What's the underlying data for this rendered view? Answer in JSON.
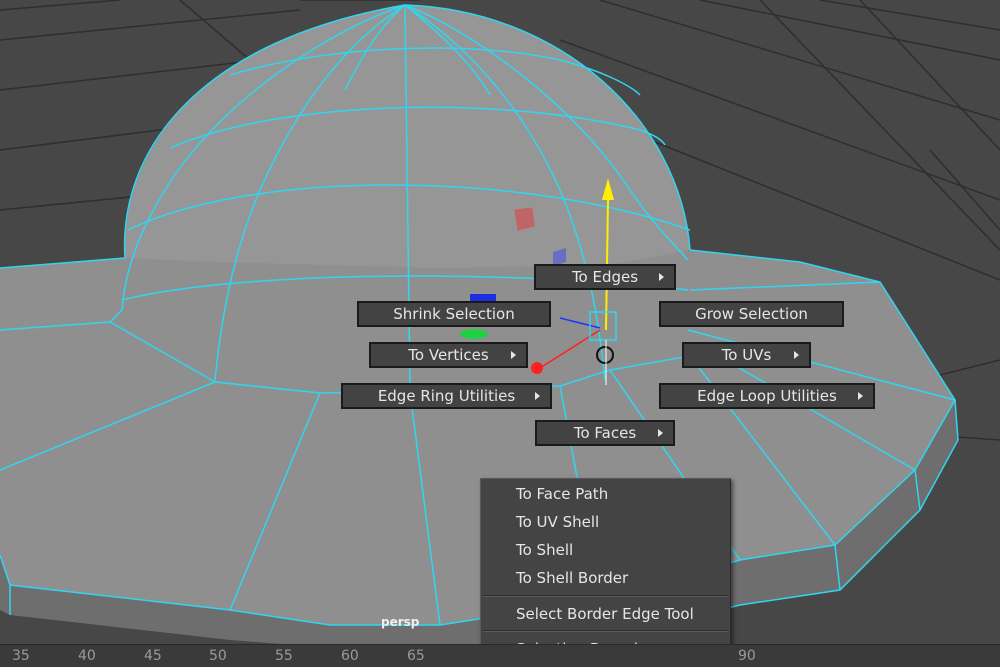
{
  "viewport": {
    "camera_label": "persp",
    "wireframe_color": "#2fd6f2",
    "background_color": "#474747",
    "mesh_color": "#8e8e8e"
  },
  "marking_menu": {
    "north": {
      "label": "To Edges",
      "has_submenu": true
    },
    "west": {
      "label": "Shrink Selection",
      "has_submenu": false
    },
    "east": {
      "label": "Grow Selection",
      "has_submenu": false
    },
    "west_lower": {
      "label": "To Vertices",
      "has_submenu": true
    },
    "east_lower": {
      "label": "To UVs",
      "has_submenu": true
    },
    "southwest": {
      "label": "Edge Ring Utilities",
      "has_submenu": true
    },
    "southeast": {
      "label": "Edge Loop Utilities",
      "has_submenu": true
    },
    "south": {
      "label": "To Faces",
      "has_submenu": true
    }
  },
  "submenu": {
    "items": [
      "To Face Path",
      "To UV Shell",
      "To Shell",
      "To Shell Border",
      "Select Border Edge Tool",
      "Selection Boundary"
    ]
  },
  "timeline": {
    "ticks": [
      "35",
      "40",
      "45",
      "50",
      "55",
      "60",
      "65",
      "90"
    ]
  },
  "manipulator": {
    "y_color": "#ffee00",
    "x_color": "#ff2020",
    "z_color": "#2233ff",
    "plane_color": "#20d040"
  }
}
